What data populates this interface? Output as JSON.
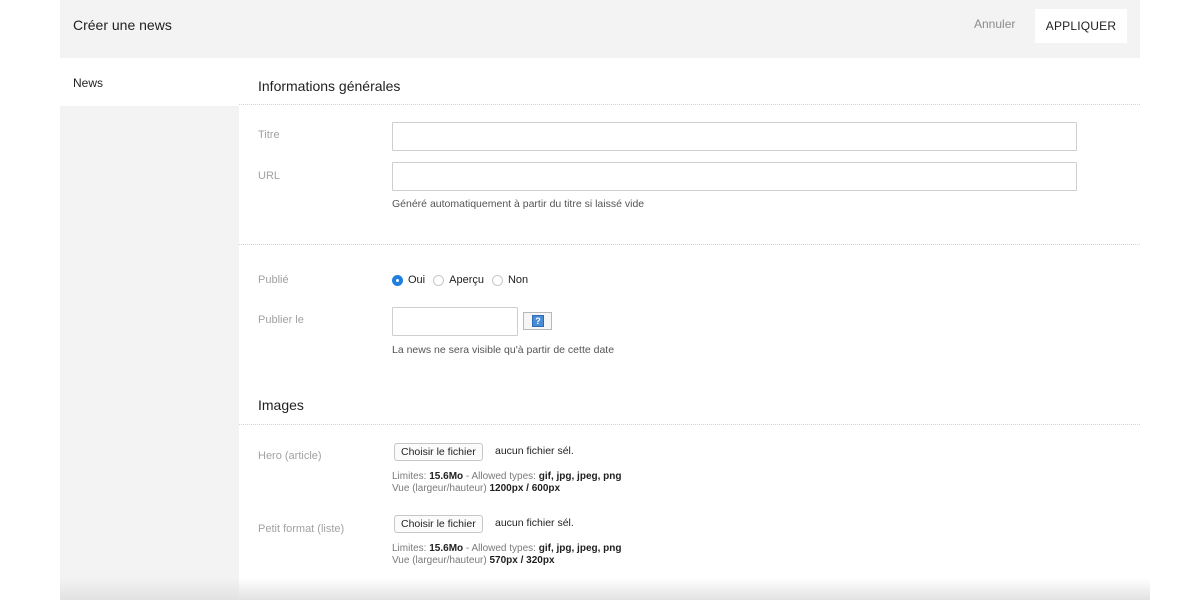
{
  "header": {
    "title": "Créer une news",
    "cancel_label": "Annuler",
    "apply_label": "APPLIQUER"
  },
  "sidebar": {
    "items": [
      {
        "label": "News",
        "active": true
      }
    ]
  },
  "general": {
    "section_title": "Informations générales",
    "title_label": "Titre",
    "title_value": "",
    "url_label": "URL",
    "url_value": "",
    "url_hint": "Généré automatiquement à partir du titre si laissé vide"
  },
  "publish": {
    "published_label": "Publié",
    "options": [
      "Oui",
      "Aperçu",
      "Non"
    ],
    "selected": "Oui",
    "publish_date_label": "Publier le",
    "publish_date_value": "",
    "calendar_icon_glyph": "?",
    "publish_date_hint": "La news ne sera visible qu'à partir de cette date"
  },
  "images": {
    "section_title": "Images",
    "fields": [
      {
        "label": "Hero (article)",
        "button_label": "Choisir le fichier",
        "file_status": "aucun fichier sél.",
        "limits_prefix": "Limites:",
        "limits_value": "15.6Mo",
        "types_prefix": " - Allowed types:",
        "types_value": "gif, jpg, jpeg, png",
        "view_prefix": "Vue (largeur/hauteur)",
        "view_value": "1200px / 600px"
      },
      {
        "label": "Petit format (liste)",
        "button_label": "Choisir le fichier",
        "file_status": "aucun fichier sél.",
        "limits_prefix": "Limites:",
        "limits_value": "15.6Mo",
        "types_prefix": " - Allowed types:",
        "types_value": "gif, jpg, jpeg, png",
        "view_prefix": "Vue (largeur/hauteur)",
        "view_value": "570px / 320px"
      }
    ]
  },
  "colors": {
    "accent": "#1e7fe0",
    "panel_bg": "#f3f3f3",
    "label_gray": "#a2a2a2"
  }
}
